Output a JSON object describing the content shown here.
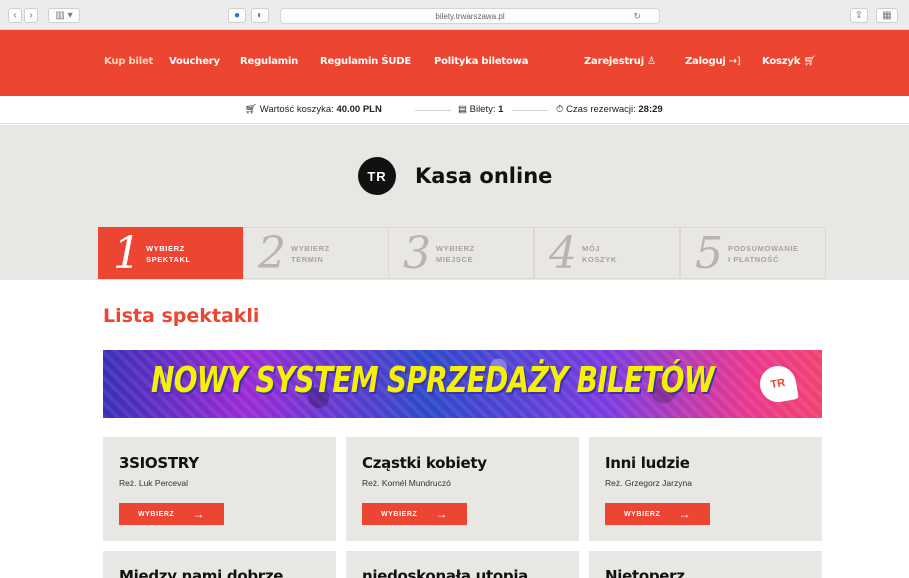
{
  "browser": {
    "url": "bilety.trwarszawa.pl"
  },
  "nav": {
    "links": [
      "Kup bilet",
      "Vouchery",
      "Regulamin",
      "Regulamin ŚUDE",
      "Polityka biletowa"
    ],
    "register": "Zarejestruj",
    "login": "Zaloguj",
    "cart": "Koszyk"
  },
  "infobar": {
    "cart_value_label": "Wartość koszyka:",
    "cart_value": "40.00 PLN",
    "tickets_label": "Bilety:",
    "tickets": "1",
    "reservation_label": "Czas rezerwacji:",
    "reservation_time": "28:29"
  },
  "hero": {
    "logo": "TR",
    "title": "Kasa online"
  },
  "steps": [
    {
      "num": "1",
      "line1": "Wybierz",
      "line2": "spektakl"
    },
    {
      "num": "2",
      "line1": "Wybierz",
      "line2": "termin"
    },
    {
      "num": "3",
      "line1": "Wybierz",
      "line2": "miejsce"
    },
    {
      "num": "4",
      "line1": "Mój",
      "line2": "koszyk"
    },
    {
      "num": "5",
      "line1": "Podsumowanie",
      "line2": "i płatność"
    }
  ],
  "list": {
    "title": "Lista spektakli",
    "banner": "NOWY SYSTEM SPRZEDAŻY BILETÓW",
    "banner_logo": "TR",
    "button_label": "WYBIERZ",
    "cards": [
      {
        "title": "3SIOSTRY",
        "director": "Reż. Luk Perceval"
      },
      {
        "title": "Cząstki kobiety",
        "director": "Reż. Kornél Mundruczó"
      },
      {
        "title": "Inni ludzie",
        "director": "Reż. Grzegorz Jarzyna"
      }
    ],
    "cards_next": [
      {
        "title": "Między nami dobrze"
      },
      {
        "title": "niedoskonała utopia"
      },
      {
        "title": "Nietoperz"
      }
    ]
  }
}
